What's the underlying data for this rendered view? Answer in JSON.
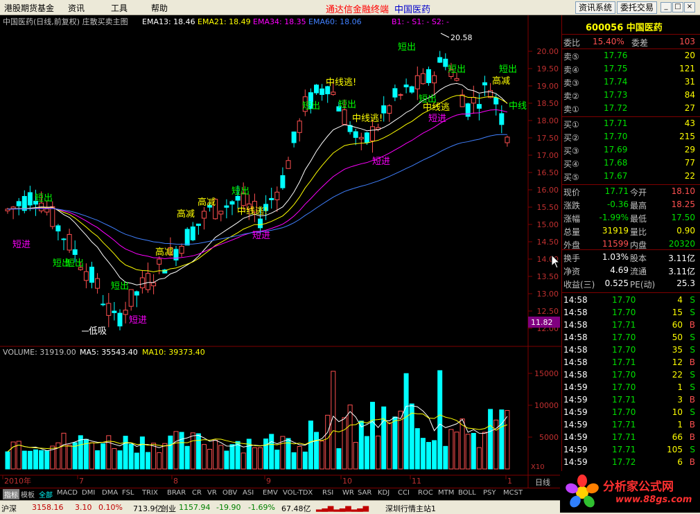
{
  "menu": {
    "items": [
      "港股期货基金",
      "资讯",
      "工具",
      "帮助"
    ],
    "title_red": "通达信金融终端",
    "title_blue": "中国医药",
    "btn_news": "资讯系统",
    "btn_trade": "委托交易"
  },
  "chart_header": {
    "name": "中国医药(日线,前复权) 庄散买卖主图",
    "ema13": "EMA13: 18.46",
    "ema21": "EMA21: 18.49",
    "ema34": "EMA34: 18.35",
    "ema60": "EMA60: 18.06",
    "signals": "B1: -  S1: -  S2: -"
  },
  "vol_header": {
    "volume": "VOLUME: 31919.00",
    "ma5": "MA5: 35543.40",
    "ma10": "MA10: 39373.40"
  },
  "annotations": {
    "high_price": "20.58",
    "low_label": "低吸",
    "current_price_tag": "11.82",
    "labels": [
      {
        "text": "短出"
      },
      {
        "text": "短进"
      },
      {
        "text": "短出"
      },
      {
        "text": "短出"
      },
      {
        "text": "短进"
      },
      {
        "text": "高减"
      },
      {
        "text": "高减"
      },
      {
        "text": "高减"
      },
      {
        "text": "中线逃!"
      },
      {
        "text": "短出"
      },
      {
        "text": "短进"
      },
      {
        "text": "短出"
      },
      {
        "text": "中线逃!"
      },
      {
        "text": "中线逃!"
      },
      {
        "text": "短出"
      },
      {
        "text": "短进"
      },
      {
        "text": "短出"
      },
      {
        "text": "短出"
      },
      {
        "text": "短出"
      },
      {
        "text": "短出"
      },
      {
        "text": "高减"
      },
      {
        "text": "短出"
      },
      {
        "text": "中线"
      },
      {
        "text": "短进"
      },
      {
        "text": "中线逃"
      }
    ]
  },
  "axis": {
    "price_ticks": [
      "20.00",
      "19.50",
      "19.00",
      "18.50",
      "18.00",
      "17.50",
      "17.00",
      "16.50",
      "16.00",
      "15.50",
      "15.00",
      "14.50",
      "14.00",
      "13.50",
      "13.00",
      "12.50",
      "12.00"
    ],
    "vol_ticks": [
      "15000",
      "10000",
      "5000"
    ],
    "vol_unit": "X10",
    "date_labels": [
      "2010年",
      "7",
      "8",
      "9",
      "10",
      "11",
      "1"
    ],
    "period": "日线"
  },
  "quote": {
    "code": "600056 中国医药",
    "weibi_label": "委比",
    "weibi": "15.40%",
    "weicha_label": "委差",
    "weicha": "103",
    "sell": [
      {
        "label": "卖⑤",
        "price": "17.76",
        "vol": "20"
      },
      {
        "label": "卖④",
        "price": "17.75",
        "vol": "121"
      },
      {
        "label": "卖③",
        "price": "17.74",
        "vol": "31"
      },
      {
        "label": "卖②",
        "price": "17.73",
        "vol": "84"
      },
      {
        "label": "卖①",
        "price": "17.72",
        "vol": "27"
      }
    ],
    "buy": [
      {
        "label": "买①",
        "price": "17.71",
        "vol": "43"
      },
      {
        "label": "买②",
        "price": "17.70",
        "vol": "215"
      },
      {
        "label": "买③",
        "price": "17.69",
        "vol": "29"
      },
      {
        "label": "买④",
        "price": "17.68",
        "vol": "77"
      },
      {
        "label": "买⑤",
        "price": "17.67",
        "vol": "22"
      }
    ],
    "stats": [
      {
        "l1": "现价",
        "v1": "17.71",
        "l2": "今开",
        "v2": "18.10"
      },
      {
        "l1": "涨跌",
        "v1": "-0.36",
        "l2": "最高",
        "v2": "18.25"
      },
      {
        "l1": "涨幅",
        "v1": "-1.99%",
        "l2": "最低",
        "v2": "17.50"
      },
      {
        "l1": "总量",
        "v1": "31919",
        "l2": "量比",
        "v2": "0.90"
      },
      {
        "l1": "外盘",
        "v1": "11599",
        "l2": "内盘",
        "v2": "20320"
      }
    ],
    "stats2": [
      {
        "l1": "换手",
        "v1": "1.03%",
        "l2": "股本",
        "v2": "3.11亿"
      },
      {
        "l1": "净资",
        "v1": "4.69",
        "l2": "流通",
        "v2": "3.11亿"
      },
      {
        "l1": "收益(三)",
        "v1": "0.525",
        "l2": "PE(动)",
        "v2": "25.3"
      }
    ],
    "ticks": [
      {
        "t": "14:58",
        "p": "17.70",
        "v": "4",
        "s": "S"
      },
      {
        "t": "14:58",
        "p": "17.70",
        "v": "15",
        "s": "S"
      },
      {
        "t": "14:58",
        "p": "17.71",
        "v": "60",
        "s": "B"
      },
      {
        "t": "14:58",
        "p": "17.70",
        "v": "50",
        "s": "S"
      },
      {
        "t": "14:58",
        "p": "17.70",
        "v": "35",
        "s": "S"
      },
      {
        "t": "14:58",
        "p": "17.71",
        "v": "12",
        "s": "B"
      },
      {
        "t": "14:58",
        "p": "17.70",
        "v": "22",
        "s": "S"
      },
      {
        "t": "14:59",
        "p": "17.70",
        "v": "1",
        "s": "S"
      },
      {
        "t": "14:59",
        "p": "17.71",
        "v": "3",
        "s": "B"
      },
      {
        "t": "14:59",
        "p": "17.70",
        "v": "10",
        "s": "S"
      },
      {
        "t": "14:59",
        "p": "17.71",
        "v": "1",
        "s": "B"
      },
      {
        "t": "14:59",
        "p": "17.71",
        "v": "66",
        "s": "B"
      },
      {
        "t": "14:59",
        "p": "17.71",
        "v": "105",
        "s": "S"
      },
      {
        "t": "14:59",
        "p": "17.72",
        "v": "6",
        "s": "B"
      },
      {
        "t": "15:00",
        "p": "17.71",
        "v": "0",
        "s": ""
      }
    ]
  },
  "tabs": [
    "指标",
    "模板",
    "全部",
    "MACD",
    "DMI",
    "DMA",
    "FSL",
    "TRIX",
    "BRAR",
    "CR",
    "VR",
    "OBV",
    "ASI",
    "EMV",
    "VOL-TDX",
    "RSI",
    "WR",
    "SAR",
    "KDJ",
    "CCI",
    "ROC",
    "MTM",
    "BOLL",
    "PSY",
    "MCST"
  ],
  "status": {
    "idx1": "沪深",
    "idx1_val": "3158.16",
    "idx1_chg": "3.10",
    "idx1_pct": "0.10%",
    "idx1_amt": "713.9亿",
    "idx2": "创业",
    "idx2_val": "1157.94",
    "idx2_chg": "-19.90",
    "idx2_pct": "-1.69%",
    "idx2_amt": "67.48亿",
    "server": "深圳行情主站1"
  },
  "logo": {
    "name": "分析家公式网",
    "url": "www.88gs.com"
  },
  "colors": {
    "up": "#ff5050",
    "down": "#00ffff",
    "ema13": "#ffffff",
    "ema21": "#ffff00",
    "ema34": "#ff00ff",
    "ema60": "#4080ff"
  }
}
